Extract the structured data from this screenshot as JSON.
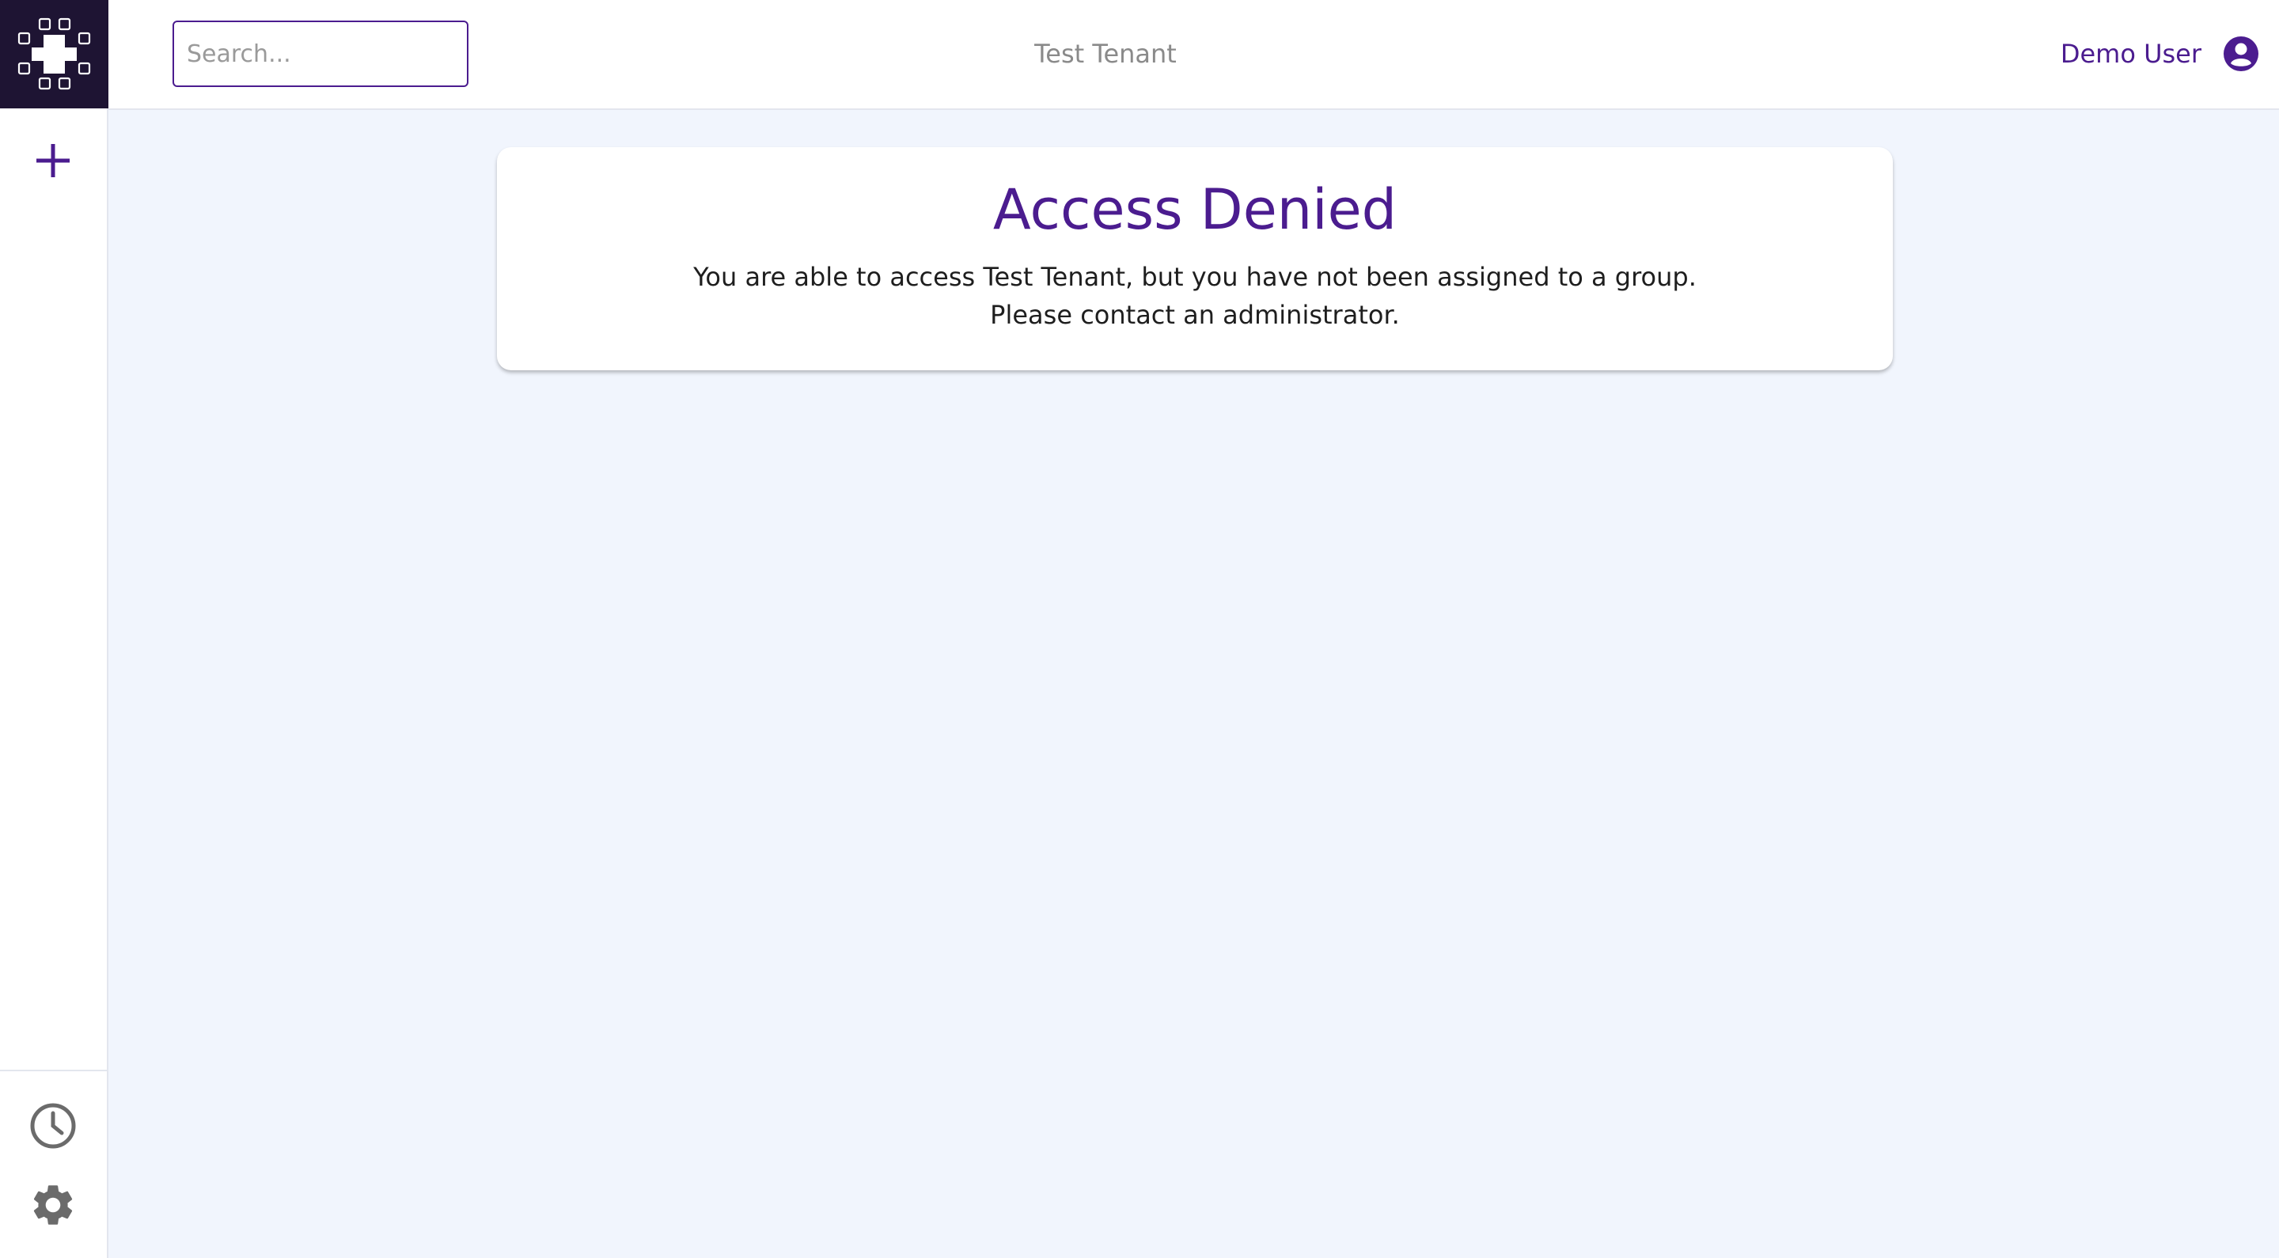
{
  "sidebar": {
    "logo_icon": "grid-cross-logo",
    "add_icon": "plus-icon",
    "history_icon": "clock-icon",
    "settings_icon": "gear-icon"
  },
  "header": {
    "search": {
      "placeholder": "Search...",
      "value": ""
    },
    "tenant_name": "Test Tenant",
    "user": {
      "name": "Demo User",
      "icon": "account-circle-icon"
    }
  },
  "main": {
    "card": {
      "title": "Access Denied",
      "message_line1": "You are able to access Test Tenant, but you have not been assigned to a group.",
      "message_line2": "Please contact an administrator."
    }
  },
  "colors": {
    "accent": "#4b1c8f",
    "logo_bg": "#1e1433",
    "page_bg": "#f1f5fd",
    "icon_gray": "#6b6b6b"
  }
}
